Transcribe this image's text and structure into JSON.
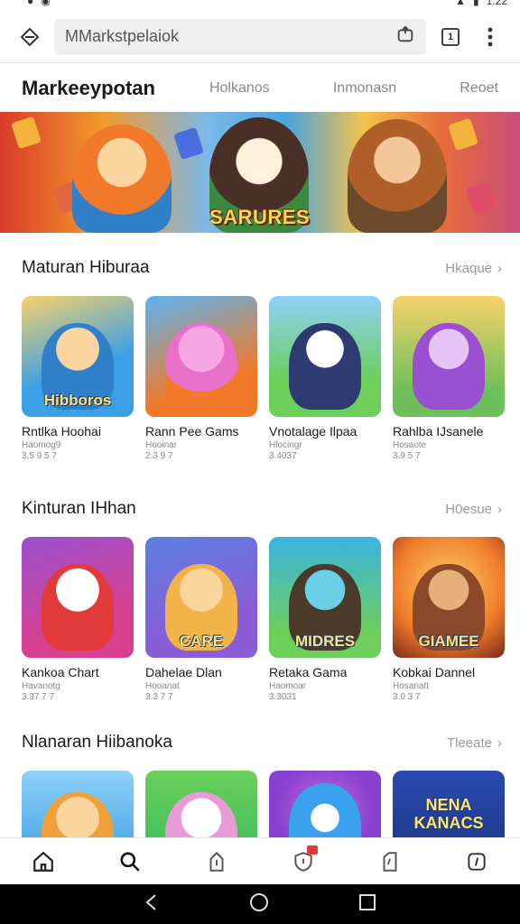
{
  "status_bar": {
    "time": "1:22"
  },
  "browser": {
    "url": "MMarkstpelaiok",
    "tab_count": "1"
  },
  "site": {
    "title": "Markeeypotan",
    "nav": [
      "Holkanos",
      "Inmonasn",
      "Reoet"
    ]
  },
  "banner": {
    "title": "SARURES"
  },
  "sections": [
    {
      "title": "Maturan Hiburaa",
      "see_more": "Hkaque",
      "apps": [
        {
          "name": "Rntlka Hoohai",
          "sub": "Haomog9",
          "rating": "3.5 9 5 7",
          "color_bg": "#3ca0e6",
          "color_char": "#f4a04a",
          "badge": "Hibboros"
        },
        {
          "name": "Rann Pee Gams",
          "sub": "Hooinar",
          "rating": "2.3 9 7",
          "color_bg": "#f07a2a",
          "color_char": "#e970c8",
          "badge": ""
        },
        {
          "name": "Vnotalage Ilpaa",
          "sub": "Hlocingr",
          "rating": "3.4037",
          "color_bg": "#6ccf5a",
          "color_char": "#2d3b72",
          "badge": ""
        },
        {
          "name": "Rahlba IJsanele",
          "sub": "Hosaote",
          "rating": "3.9 5 7",
          "color_bg": "#f3b43a",
          "color_char": "#9a4fd0",
          "badge": ""
        }
      ]
    },
    {
      "title": "Kinturan IHhan",
      "see_more": "H0esue",
      "apps": [
        {
          "name": "Kankoa Chart",
          "sub": "Havanotg",
          "rating": "3.37 7 7",
          "color_bg": "#d6408e",
          "color_char": "#ffffff",
          "badge": ""
        },
        {
          "name": "Dahelae Dlan",
          "sub": "Hooanat",
          "rating": "3.3 7 7",
          "color_bg": "#8a5cd6",
          "color_char": "#f2b44a",
          "badge": "CARE"
        },
        {
          "name": "Retaka Gama",
          "sub": "Haomoar",
          "rating": "3.3031",
          "color_bg": "#3cb3e0",
          "color_char": "#4a3a2a",
          "badge": "MIDRES"
        },
        {
          "name": "Kobkai Dannel",
          "sub": "Hosanatt",
          "rating": "3.0 3 7",
          "color_bg": "#f07a2a",
          "color_char": "#8a4a2a",
          "badge": "GIAMEE"
        }
      ]
    },
    {
      "title": "Nlanaran Hiibanoka",
      "see_more": "Tleeate",
      "apps": [
        {
          "color_bg": "#4aa8e8",
          "color_char": "#f0a03a",
          "badge": ""
        },
        {
          "color_bg": "#3fbf5a",
          "color_char": "#e99ad8",
          "badge": ""
        },
        {
          "color_bg": "#8a3fd0",
          "color_char": "#3aa0f0",
          "badge": ""
        },
        {
          "color_bg": "#1e3a8a",
          "color_char": "#f2c94a",
          "badge": "NENA KANACS"
        }
      ]
    }
  ]
}
